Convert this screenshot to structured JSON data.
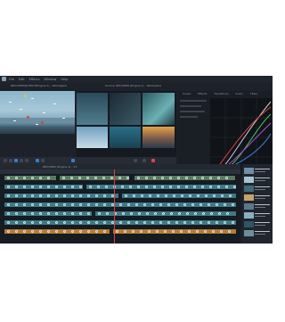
{
  "app": {
    "name": "MAGIX video editor"
  },
  "menubar": [
    "File",
    "Edit",
    "Effects",
    "Window",
    "Help"
  ],
  "panels": {
    "viewer_left": "REC/VIEW/OUTPUT(Engine 1) - Workspace",
    "viewer_right": "Source: REC/VIEW (Engine 1) - Workspace",
    "scopes_tabs": [
      "Scope",
      "Effects",
      "Transitions",
      "Audio",
      "Titles"
    ]
  },
  "timeline": {
    "title": "REC/VIEW (Engine 1) - V1"
  },
  "colors": {
    "background": "#1d2129",
    "accent": "#2f7fd6",
    "clip_green": "#5a7a5e",
    "clip_cyan": "#3f7986",
    "clip_orange": "#b87a2e",
    "marker_red": "#e2403f",
    "marker_yellow": "#e6c23a"
  }
}
